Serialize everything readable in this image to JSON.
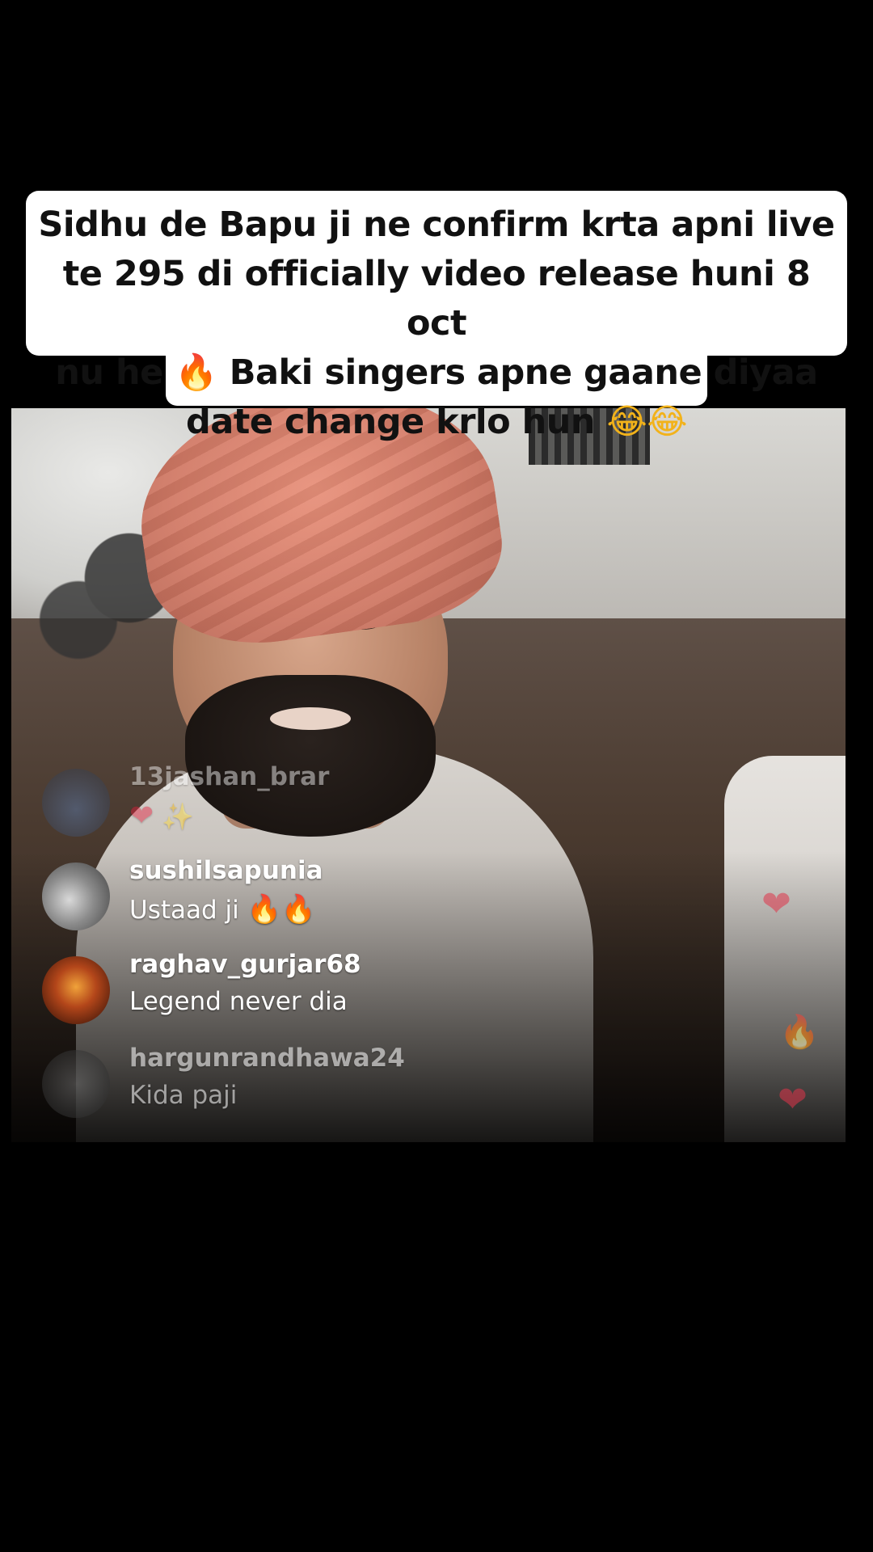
{
  "caption": {
    "line1": "Sidhu de Bapu ji ne confirm krta apni live",
    "line2": "te 295 di officially video release huni 8 oct",
    "line3_prefix": "nu he ",
    "line3_emoji": "🔥",
    "line3_suffix": " Baki singers apne gaane diyaa",
    "line4_text": "date change krlo hun ",
    "line4_emoji": "😂😂"
  },
  "comments": [
    {
      "username": "13jashan_brar",
      "message_emoji_1": "❤",
      "message_emoji_2": "✨",
      "faded": true
    },
    {
      "username": "sushilsapunia",
      "message": "Ustaad ji",
      "message_emoji": "🔥🔥"
    },
    {
      "username": "raghav_gurjar68",
      "message": "Legend never dia"
    },
    {
      "username": "hargunrandhawa24",
      "message": "Kida paji",
      "faded": true
    }
  ],
  "reactions": {
    "heart_1": "❤",
    "fire_1": "🔥",
    "heart_2": "❤"
  },
  "colors": {
    "background": "#000000",
    "caption_bg": "#ffffff",
    "caption_text": "#111111",
    "turban": "#d27a66"
  }
}
